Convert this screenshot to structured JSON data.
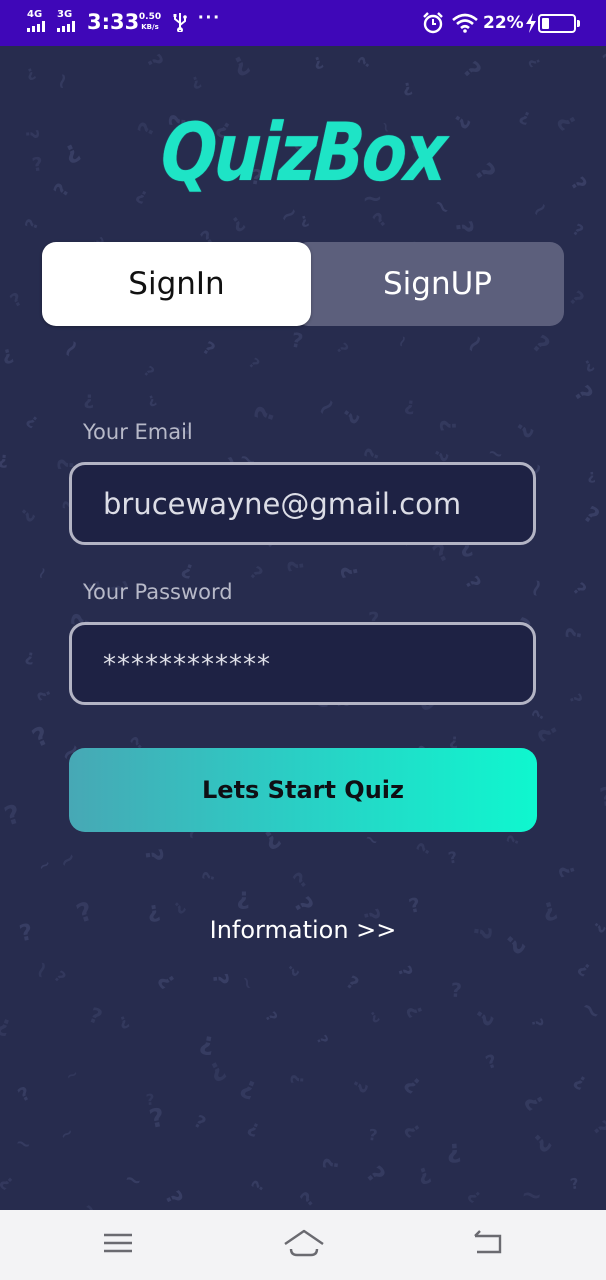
{
  "status_bar": {
    "network_1": "4G",
    "network_2": "3G",
    "time": "3:33",
    "speed_value": "0.50",
    "speed_unit": "KB/s",
    "more": "···",
    "battery_pct": "22%",
    "battery_level": 0.22,
    "icons": [
      "signal-icon",
      "usb-icon",
      "alarm-icon",
      "wifi-icon",
      "charging-icon",
      "battery-icon"
    ],
    "background": "#3f07b8"
  },
  "app": {
    "logo": "QuizBox",
    "accent": "#1ee4c6",
    "background": "#272c4e"
  },
  "tabs": {
    "signin": "SignIn",
    "signup": "SignUP",
    "active": "signin"
  },
  "form": {
    "email_label": "Your Email",
    "email_value": "brucewayne@gmail.com",
    "password_label": "Your Password",
    "password_value": "************",
    "submit_label": "Lets Start Quiz"
  },
  "info_link": "Information >>",
  "nav_bar": {
    "icons": [
      "menu-icon",
      "home-icon",
      "back-icon"
    ]
  }
}
